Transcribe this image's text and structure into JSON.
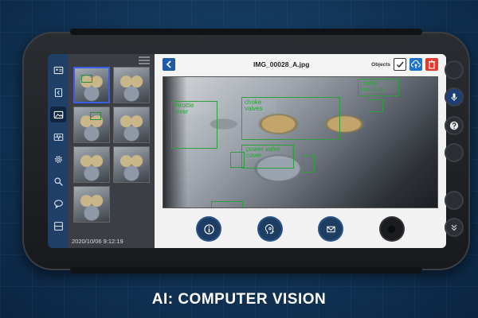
{
  "main": {
    "filename": "IMG_00028_A.jpg",
    "objects_label": "Objects",
    "detections": [
      {
        "label": "throttle lever"
      },
      {
        "label": "choke valves"
      },
      {
        "label": "power valve cover"
      },
      {
        "label": "choke housing"
      }
    ]
  },
  "gallery": {
    "timestamp": "2020/10/06  9:12:19",
    "thumbnail_count": 7
  },
  "sidebar": {
    "items": [
      {
        "icon": "id-card-icon"
      },
      {
        "icon": "book-icon"
      },
      {
        "icon": "image-icon",
        "active": true
      },
      {
        "icon": "waveform-icon"
      },
      {
        "icon": "gear-icon"
      },
      {
        "icon": "search-icon"
      },
      {
        "icon": "chat-icon"
      },
      {
        "icon": "panel-icon"
      }
    ]
  },
  "bottombar": {
    "buttons": [
      "info-icon",
      "ai-head-icon",
      "mail-icon",
      "record-icon"
    ]
  },
  "caption": "AI: COMPUTER VISION"
}
